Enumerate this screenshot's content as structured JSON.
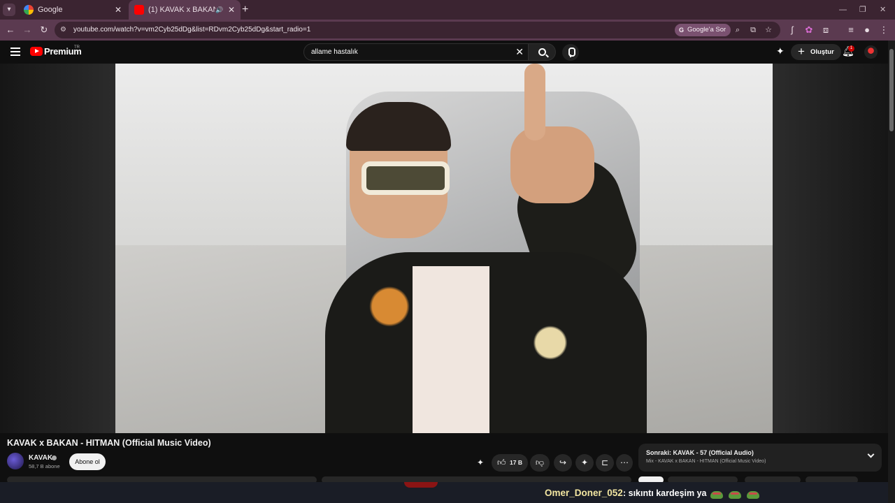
{
  "browser": {
    "tabs": [
      {
        "title": "Google"
      },
      {
        "title": "(1) KAVAK x BAKAN - HITM"
      }
    ],
    "url": "youtube.com/watch?v=vm2Cyb25dDg&list=RDvm2Cyb25dDg&start_radio=1",
    "google_ask": "Google'a Sor"
  },
  "youtube": {
    "brand": "Premium",
    "region": "TR",
    "search_value": "allame hastalık",
    "create_label": "Oluştur",
    "notification_count": "1"
  },
  "video": {
    "title": "KAVAK x BAKAN - HITMAN (Official Music Video)",
    "channel_name": "KAVAK",
    "subscribers": "58,7 B abone",
    "subscribe_label": "Abone ol",
    "likes": "17 B"
  },
  "up_next": {
    "title": "Sonraki: KAVAK - 57 (Official Audio)",
    "subtitle": "Mix - KAVAK x BAKAN - HITMAN (Official Music Video)"
  },
  "chat": {
    "username": "Omer_Doner_052",
    "message": ": sıkıntı kardeşim ya"
  },
  "colors": {
    "accent": "#ff0000",
    "tab_bar": "#3b2431",
    "chat_user": "#f3e6a1"
  }
}
